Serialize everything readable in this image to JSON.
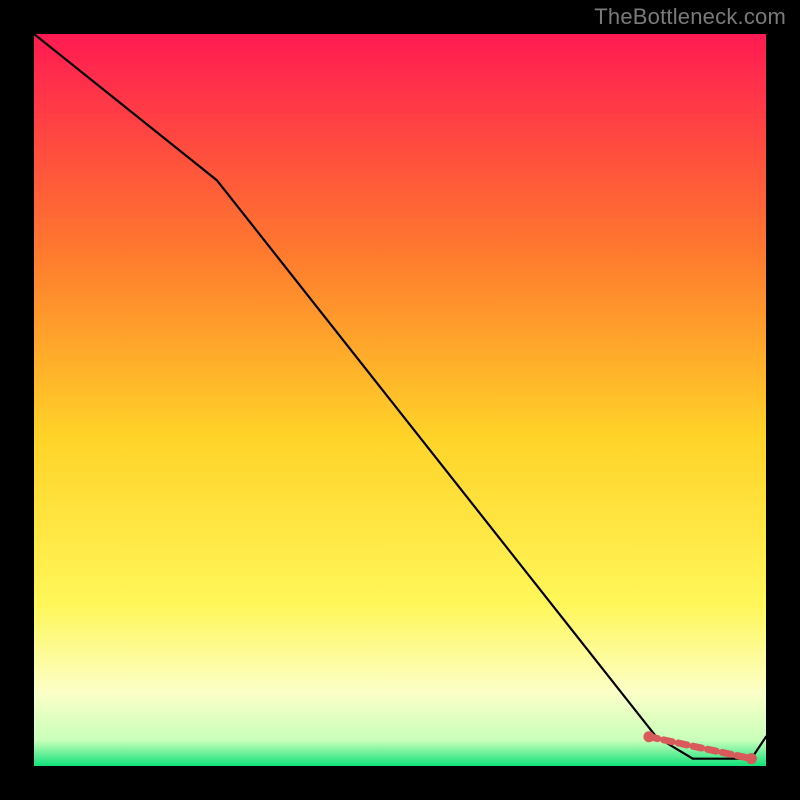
{
  "attribution": "TheBottleneck.com",
  "colors": {
    "gradient_top": "#ff1a52",
    "gradient_mid_upper": "#ff8a2a",
    "gradient_mid": "#ffe228",
    "gradient_lower": "#fbffb8",
    "gradient_bottom": "#10e27a",
    "line": "#000000",
    "marker": "#d85a5a",
    "frame": "#000000"
  },
  "chart_data": {
    "type": "line",
    "title": "",
    "xlabel": "",
    "ylabel": "",
    "xlim": [
      0,
      100
    ],
    "ylim": [
      0,
      100
    ],
    "series": [
      {
        "name": "curve",
        "x": [
          0,
          25,
          85,
          90,
          95,
          98,
          100
        ],
        "y": [
          100,
          80,
          4,
          1,
          1,
          1,
          4
        ]
      }
    ],
    "markers": {
      "name": "highlight-segment",
      "x": [
        84,
        98
      ],
      "y": [
        4,
        1
      ]
    }
  }
}
